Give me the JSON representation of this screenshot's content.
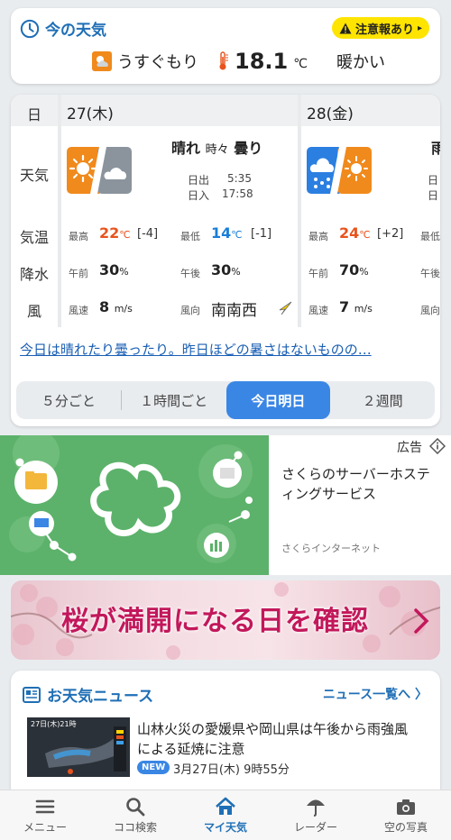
{
  "now": {
    "title": "今の天気",
    "warning": "注意報あり",
    "condition": "うすぐもり",
    "temp": "18.1",
    "unit": "℃",
    "feel": "暖かい"
  },
  "forecast": {
    "labels": {
      "day": "日",
      "weather": "天気",
      "temp": "気温",
      "precip": "降水",
      "wind": "風"
    },
    "day1": {
      "date": "27(木)",
      "cond_main": "晴れ",
      "cond_sep": "時々",
      "cond_sub": "曇り",
      "sunrise_lbl": "日出",
      "sunrise": "5:35",
      "sunset_lbl": "日入",
      "sunset": "17:58",
      "max_lbl": "最高",
      "max": "22",
      "max_diff": "[-4]",
      "min_lbl": "最低",
      "min": "14",
      "min_diff": "[-1]",
      "am_lbl": "午前",
      "am": "30",
      "pm_lbl": "午後",
      "pm": "30",
      "ws_lbl": "風速",
      "ws": "8",
      "ws_unit": "m/s",
      "wd_lbl": "風向",
      "wd": "南南西"
    },
    "day2": {
      "date": "28(金)",
      "cond_main": "雨",
      "sunrise_lbl": "日",
      "sunset_lbl": "日",
      "max_lbl": "最高",
      "max": "24",
      "max_diff": "[+2]",
      "min_lbl": "最低",
      "am_lbl": "午前",
      "am": "70",
      "pm_lbl": "午後",
      "ws_lbl": "風速",
      "ws": "7",
      "ws_unit": "m/s",
      "wd_lbl": "風向"
    },
    "deg": "℃",
    "pct": "%",
    "summary_link": "今日は晴れたり曇ったり。昨日ほどの暑さはないものの…",
    "tabs": [
      "５分ごと",
      "１時間ごと",
      "今日明日",
      "２週間"
    ],
    "active_tab": 2
  },
  "ad": {
    "label": "広告",
    "title": "さくらのサーバーホスティングサービス",
    "source": "さくらインターネット"
  },
  "sakura": {
    "text": "桜が満開になる日を確認"
  },
  "news": {
    "header": "お天気ニュース",
    "more": "ニュース一覧へ",
    "thumb_caption": "27日(木)21時",
    "title": "山林火災の愛媛県や岡山県は午後から雨強風による延焼に注意",
    "badge": "NEW",
    "time": "3月27日(木) 9時55分"
  },
  "nav": [
    {
      "label": "メニュー",
      "icon": "menu-icon"
    },
    {
      "label": "ココ検索",
      "icon": "search-icon"
    },
    {
      "label": "マイ天気",
      "icon": "home-icon"
    },
    {
      "label": "レーダー",
      "icon": "radar-umbrella-icon"
    },
    {
      "label": "空の写真",
      "icon": "camera-icon"
    }
  ],
  "colors": {
    "accent": "#1f6fb6",
    "active_tab": "#3a86e4",
    "warning": "#ffe400",
    "hot": "#e8531d",
    "cold": "#1a7ed9"
  }
}
